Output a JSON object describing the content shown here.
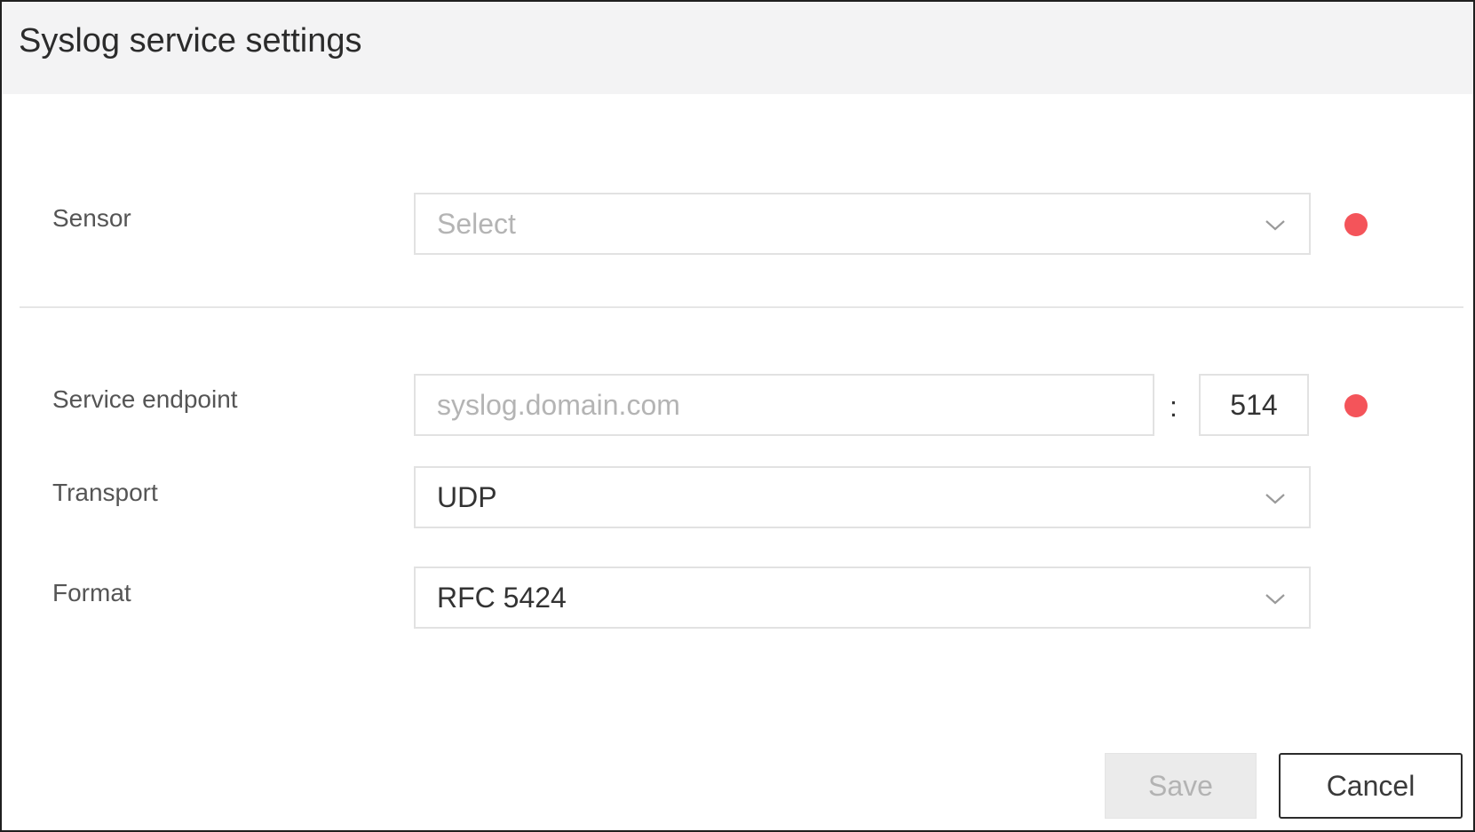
{
  "dialog": {
    "title": "Syslog service settings"
  },
  "sensor": {
    "label": "Sensor",
    "placeholder": "Select",
    "required": true
  },
  "service_endpoint": {
    "label": "Service endpoint",
    "host_placeholder": "syslog.domain.com",
    "separator": ":",
    "port_value": "514",
    "required": true
  },
  "transport": {
    "label": "Transport",
    "selected": "UDP"
  },
  "format": {
    "label": "Format",
    "selected": "RFC 5424"
  },
  "actions": {
    "save_label": "Save",
    "save_disabled": true,
    "cancel_label": "Cancel"
  },
  "colors": {
    "required_indicator": "#f4545a",
    "header_background": "#f3f3f4",
    "field_border": "#e2e2e2",
    "disabled_button": "#ebebeb"
  },
  "icons": {
    "dropdown": "chevron-down-icon",
    "required": "required-dot-icon"
  }
}
